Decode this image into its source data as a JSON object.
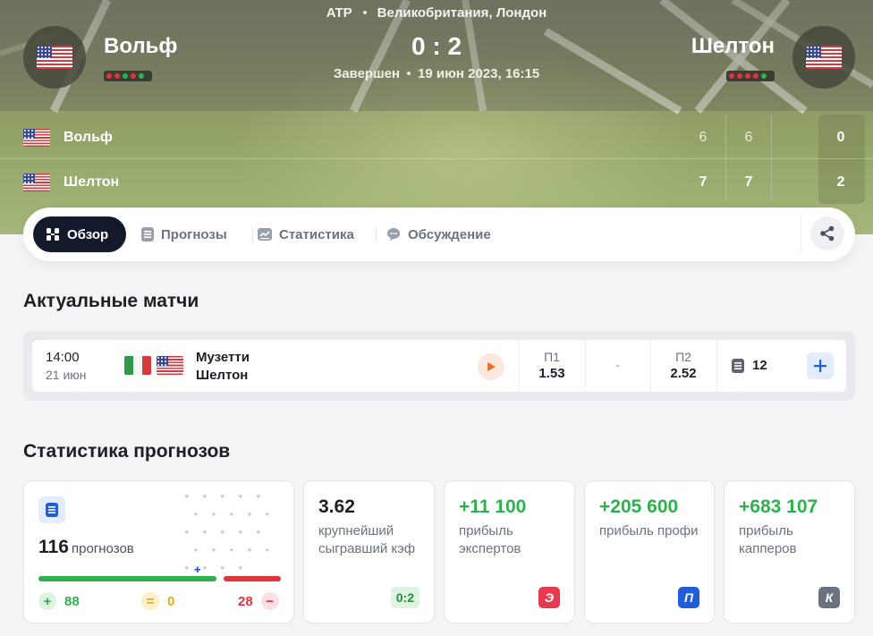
{
  "match": {
    "tour": "ATP",
    "location": "Великобритания, Лондон",
    "score": "0 : 2",
    "status": "Завершен",
    "datetime": "19 июн 2023, 16:15",
    "player1": {
      "name": "Вольф",
      "flag": "us-flag-icon",
      "form": [
        "l",
        "l",
        "w",
        "l",
        "w"
      ]
    },
    "player2": {
      "name": "Шелтон",
      "flag": "us-flag-icon",
      "form": [
        "l",
        "l",
        "l",
        "l",
        "w"
      ]
    }
  },
  "sets": {
    "rows": [
      {
        "name": "Вольф",
        "set1": "6",
        "set2": "6",
        "total": "0"
      },
      {
        "name": "Шелтон",
        "set1": "7",
        "set2": "7",
        "total": "2"
      }
    ]
  },
  "tabs": [
    {
      "label": "Обзор",
      "icon": "overview-icon",
      "active": true
    },
    {
      "label": "Прогнозы",
      "icon": "forecast-doc-icon",
      "active": false
    },
    {
      "label": "Статистика",
      "icon": "stats-icon",
      "active": false
    },
    {
      "label": "Обсуждение",
      "icon": "chat-icon",
      "active": false
    }
  ],
  "share_icon": "share-icon",
  "sections": {
    "actual_matches": "Актуальные матчи",
    "forecast_stats": "Статистика прогнозов"
  },
  "actual_match": {
    "time": "14:00",
    "date": "21 июн",
    "player1": "Музетти",
    "player2": "Шелтон",
    "flag1": "it-flag-icon",
    "flag2": "us-flag-icon",
    "odd1_label": "П1",
    "odd1_value": "1.53",
    "draw": "-",
    "odd2_label": "П2",
    "odd2_value": "2.52",
    "forecasts_count": "12"
  },
  "forecast_stats": {
    "total_count": "116",
    "total_label": "прогнозов",
    "win": "88",
    "win_symbol": "+",
    "draw": "0",
    "draw_symbol": "=",
    "lose": "28",
    "lose_symbol": "−",
    "cards": [
      {
        "value": "3.62",
        "desc": "крупнейший сыгравший кэф",
        "tag": "0:2"
      },
      {
        "value": "+11 100",
        "desc": "прибыль экспертов",
        "tag": "Э"
      },
      {
        "value": "+205 600",
        "desc": "прибыль профи",
        "tag": "П"
      },
      {
        "value": "+683 107",
        "desc": "прибыль капперов",
        "tag": "К"
      }
    ]
  },
  "colors": {
    "accent_dark": "#141a2b",
    "win_green": "#2bb24c",
    "lose_red": "#e2343b",
    "draw_yellow": "#e7a90c",
    "brand_blue": "#1f5ed6"
  }
}
